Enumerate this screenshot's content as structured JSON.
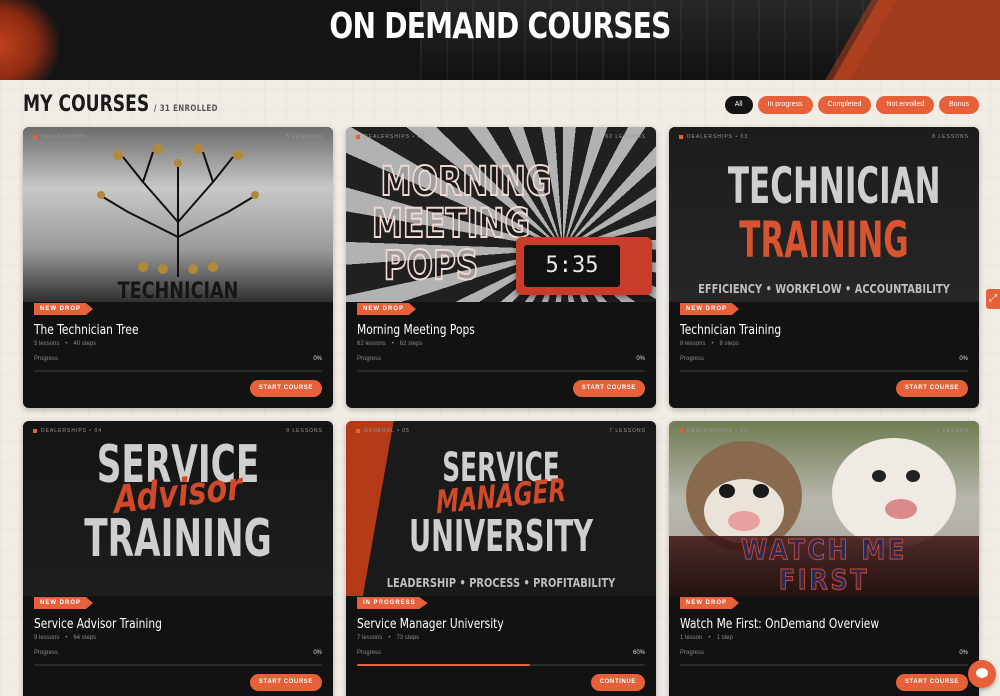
{
  "hero": {
    "title": "ON DEMAND COURSES"
  },
  "section": {
    "title": "MY COURSES",
    "enrolled": "/ 31 ENROLLED"
  },
  "filters": [
    "All",
    "In progress",
    "Completed",
    "Not enrolled",
    "Bonus"
  ],
  "colors": {
    "accent": "#e6603a",
    "card_bg": "#121212",
    "page_bg": "#f1ede6"
  },
  "courses": [
    {
      "category": "DEALERSHIPS",
      "lessons_count": "5 LESSONS",
      "thumb_text": [
        "TECHNICIAN"
      ],
      "badge": "NEW DROP",
      "title": "The Technician Tree",
      "lessons": "5 lessons",
      "steps": "40 steps",
      "progress_label": "Progress",
      "progress": "0%",
      "progress_fraction": 0,
      "button": "START COURSE"
    },
    {
      "category": "DEALERSHIPS • 02",
      "lessons_count": "62 LESSONS",
      "thumb_text": [
        "MORNING",
        "MEETING",
        "POPS"
      ],
      "clock_time": "5:35",
      "badge": "NEW DROP",
      "title": "Morning Meeting Pops",
      "lessons": "62 lessons",
      "steps": "62 steps",
      "progress_label": "Progress",
      "progress": "0%",
      "progress_fraction": 0,
      "button": "START COURSE"
    },
    {
      "category": "DEALERSHIPS • 03",
      "lessons_count": "8 LESSONS",
      "thumb_text": [
        "TECHNICIAN",
        "TRAINING",
        "EFFICIENCY • WORKFLOW • ACCOUNTABILITY"
      ],
      "badge": "NEW DROP",
      "title": "Technician Training",
      "lessons": "8 lessons",
      "steps": "8 steps",
      "progress_label": "Progress",
      "progress": "0%",
      "progress_fraction": 0,
      "button": "START COURSE"
    },
    {
      "category": "DEALERSHIPS • 04",
      "lessons_count": "9 LESSONS",
      "thumb_text": [
        "SERVICE",
        "Advisor",
        "TRAINING"
      ],
      "badge": "NEW DROP",
      "title": "Service Advisor Training",
      "lessons": "9 lessons",
      "steps": "64 steps",
      "progress_label": "Progress",
      "progress": "0%",
      "progress_fraction": 0,
      "button": "START COURSE"
    },
    {
      "category": "GENERAL • 05",
      "lessons_count": "7 LESSONS",
      "thumb_text": [
        "SERVICE",
        "MANAGER",
        "UNIVERSITY",
        "LEADERSHIP • PROCESS • PROFITABILITY"
      ],
      "badge": "IN PROGRESS",
      "title": "Service Manager University",
      "lessons": "7 lessons",
      "steps": "73 steps",
      "progress_label": "Progress",
      "progress": "60%",
      "progress_fraction": 0.6,
      "button": "CONTINUE"
    },
    {
      "category": "DEALERSHIPS • 06",
      "lessons_count": "1 LESSON",
      "thumb_text": [
        "WATCH ME",
        "FIRST"
      ],
      "badge": "NEW DROP",
      "title": "Watch Me First: OnDemand Overview",
      "lessons": "1 lesson",
      "steps": "1 step",
      "progress_label": "Progress",
      "progress": "0%",
      "progress_fraction": 0,
      "button": "START COURSE"
    }
  ]
}
